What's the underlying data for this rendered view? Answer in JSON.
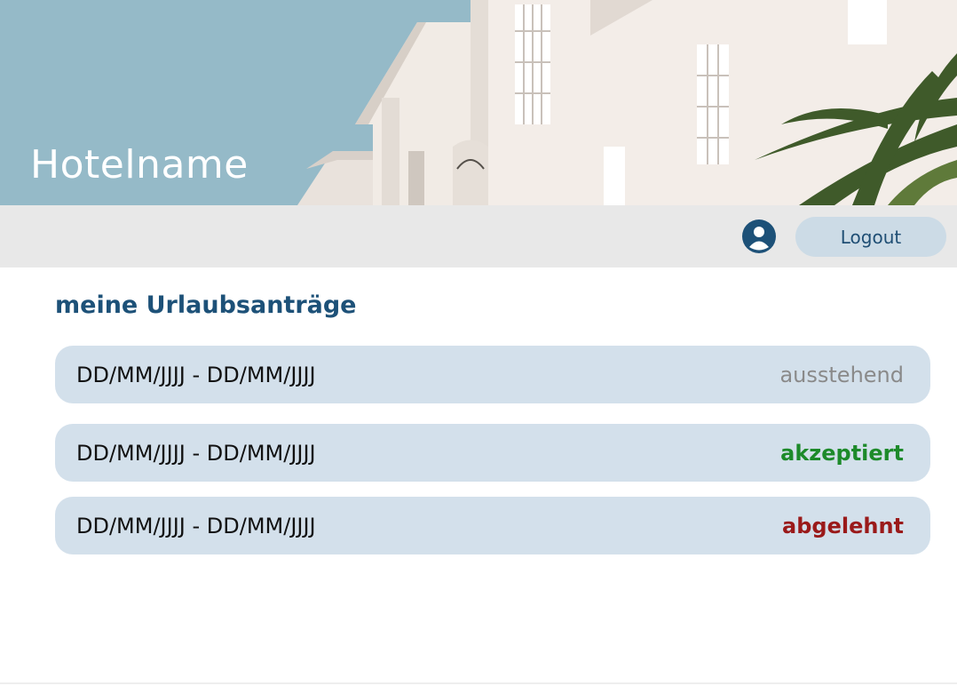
{
  "header": {
    "hotel_name": "Hotelname"
  },
  "toolbar": {
    "user_icon": "user-circle-icon",
    "logout_label": "Logout"
  },
  "main": {
    "title": "meine Urlaubsanträge",
    "requests": [
      {
        "dates": "DD/MM/JJJJ - DD/MM/JJJJ",
        "status": "ausstehend"
      },
      {
        "dates": "DD/MM/JJJJ - DD/MM/JJJJ",
        "status": "akzeptiert"
      },
      {
        "dates": "DD/MM/JJJJ - DD/MM/JJJJ",
        "status": "abgelehnt"
      }
    ]
  },
  "colors": {
    "primary": "#1d5178",
    "row_background": "#d3e0eb",
    "status_pending": "#8a8a8a",
    "status_accepted": "#1d8a2a",
    "status_rejected": "#9a1a1a"
  }
}
